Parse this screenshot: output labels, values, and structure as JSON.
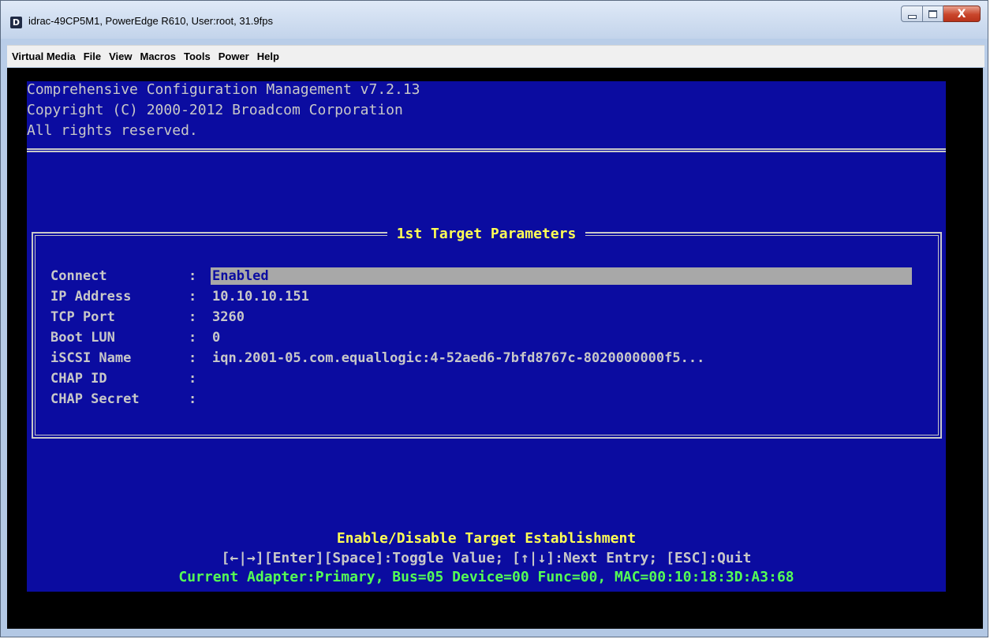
{
  "window": {
    "title": "idrac-49CP5M1, PowerEdge R610, User:root, 31.9fps",
    "app_icon_glyph": "D",
    "close_glyph": "X"
  },
  "menu": {
    "items": [
      "Virtual Media",
      "File",
      "View",
      "Macros",
      "Tools",
      "Power",
      "Help"
    ]
  },
  "console": {
    "header": [
      "Comprehensive Configuration Management v7.2.13",
      "Copyright (C) 2000-2012 Broadcom Corporation",
      "All rights reserved."
    ],
    "panel_title": "1st Target Parameters",
    "fields": [
      {
        "label": "Connect",
        "value": "Enabled",
        "selected": true
      },
      {
        "label": "IP Address",
        "value": "10.10.10.151"
      },
      {
        "label": "TCP Port",
        "value": "3260"
      },
      {
        "label": "Boot LUN",
        "value": "0"
      },
      {
        "label": "iSCSI Name",
        "value": "iqn.2001-05.com.equallogic:4-52aed6-7bfd8767c-8020000000f5..."
      },
      {
        "label": "CHAP ID",
        "value": ""
      },
      {
        "label": "CHAP Secret",
        "value": ""
      }
    ],
    "separator": ":",
    "help_title": "Enable/Disable Target Establishment",
    "help_keys": "[←|→][Enter][Space]:Toggle Value; [↑|↓]:Next Entry; [ESC]:Quit",
    "adapter_info": "Current Adapter:Primary, Bus=05 Device=00 Func=00, MAC=00:10:18:3D:A3:68"
  },
  "colors": {
    "console_background": "#0b0ca0",
    "console_text": "#c8c8c8",
    "help_title": "#ffff55",
    "adapter_info": "#55ff55",
    "selection": "#a8a8a8"
  }
}
